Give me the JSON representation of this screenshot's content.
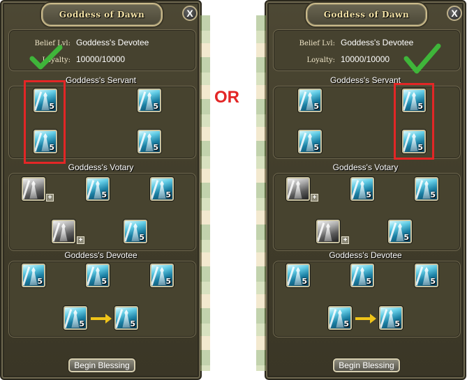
{
  "separator": "OR",
  "window": {
    "title": "Goddess of Dawn",
    "close_label": "X",
    "belief_label": "Belief Lvl:",
    "belief_value": "Goddess's Devotee",
    "loyalty_label": "Loyalty:",
    "loyalty_value": "10000/10000",
    "begin_button": "Begin Blessing"
  },
  "sections": {
    "servant": "Goddess's Servant",
    "votary": "Goddess's Votary",
    "devotee": "Goddess's Devotee"
  },
  "skill_level": "5",
  "plus_symbol": "+",
  "colors": {
    "highlight_red": "#e32626",
    "check_green": "#3fb53a",
    "arrow_yellow": "#f0c419",
    "panel_bg": "#45412e"
  },
  "annotations": {
    "left_highlight": "left column of Goddess's Servant skills",
    "right_highlight": "right column of Goddess's Servant skills"
  }
}
